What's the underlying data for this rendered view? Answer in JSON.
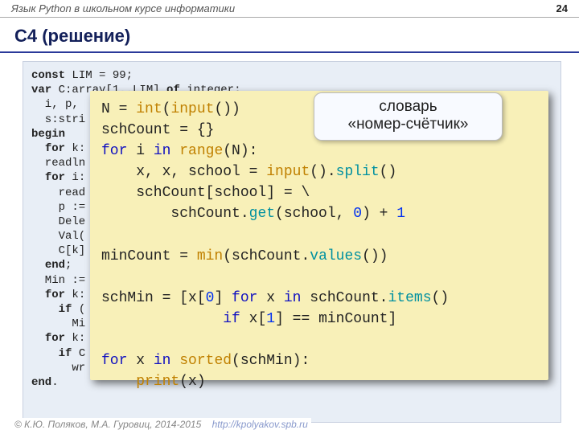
{
  "topbar": {
    "subtitle": "Язык Python в школьном курсе информатики",
    "page": "24"
  },
  "title": "C4 (решение)",
  "pascal": {
    "l1": {
      "a": "const",
      "b": " LIM = 99;"
    },
    "l2": {
      "a": "var",
      "b": " C:array[1..LIM] ",
      "c": "of",
      "d": " integer;"
    },
    "l3": "  i, p,",
    "l4": "  s:stri",
    "l5": {
      "a": "begin"
    },
    "l6": {
      "a": "  ",
      "b": "for",
      "c": " k:"
    },
    "l7": "  readln",
    "l8": {
      "a": "  ",
      "b": "for",
      "c": " i:"
    },
    "l9": "    read",
    "l10": "    p :=",
    "l11": "    Dele",
    "l12": "    Val(",
    "l13": "    C[k]",
    "l14": {
      "a": "  ",
      "b": "end",
      "c": ";"
    },
    "l15": "  Min :=",
    "l16": {
      "a": "  ",
      "b": "for",
      "c": " k:"
    },
    "l17": {
      "a": "    ",
      "b": "if",
      "c": " ("
    },
    "l18": "      Mi",
    "l19": {
      "a": "  ",
      "b": "for",
      "c": " k:"
    },
    "l20": {
      "a": "    ",
      "b": "if",
      "c": " C"
    },
    "l21": "      wr",
    "l22": {
      "a": "end",
      "b": "."
    }
  },
  "python": {
    "l1": {
      "a": "N = ",
      "b": "int",
      "c": "(",
      "d": "input",
      "e": "())"
    },
    "l2": "schCount = {}",
    "l3": {
      "a": "for",
      "b": " i ",
      "c": "in",
      "d": " ",
      "e": "range",
      "f": "(N):"
    },
    "l4": {
      "a": "    x, x, school = ",
      "b": "input",
      "c": "().",
      "d": "split",
      "e": "()"
    },
    "l5": "    schCount[school] = \\",
    "l6": {
      "a": "        schCount.",
      "b": "get",
      "c": "(school, ",
      "d": "0",
      "e": ") + ",
      "f": "1"
    },
    "l7": "",
    "l8": {
      "a": "minCount = ",
      "b": "min",
      "c": "(schCount.",
      "d": "values",
      "e": "())"
    },
    "l9": "",
    "l10": {
      "a": "schMin = [x[",
      "b": "0",
      "c": "] ",
      "d": "for",
      "e": " x ",
      "f": "in",
      "g": " schCount.",
      "h": "items",
      "i": "()"
    },
    "l11": {
      "a": "              ",
      "b": "if",
      "c": " x[",
      "d": "1",
      "e": "] == minCount]"
    },
    "l12": "",
    "l13": {
      "a": "for",
      "b": " x ",
      "c": "in",
      "d": " ",
      "e": "sorted",
      "f": "(schMin):"
    },
    "l14": {
      "a": "    ",
      "b": "print",
      "c": "(x)"
    }
  },
  "annotation": {
    "line1": "словарь",
    "line2": "«номер-счётчик»"
  },
  "footer": {
    "copy": "© К.Ю. Поляков, М.А. Гуровиц, 2014-2015",
    "link": "http://kpolyakov.spb.ru"
  }
}
